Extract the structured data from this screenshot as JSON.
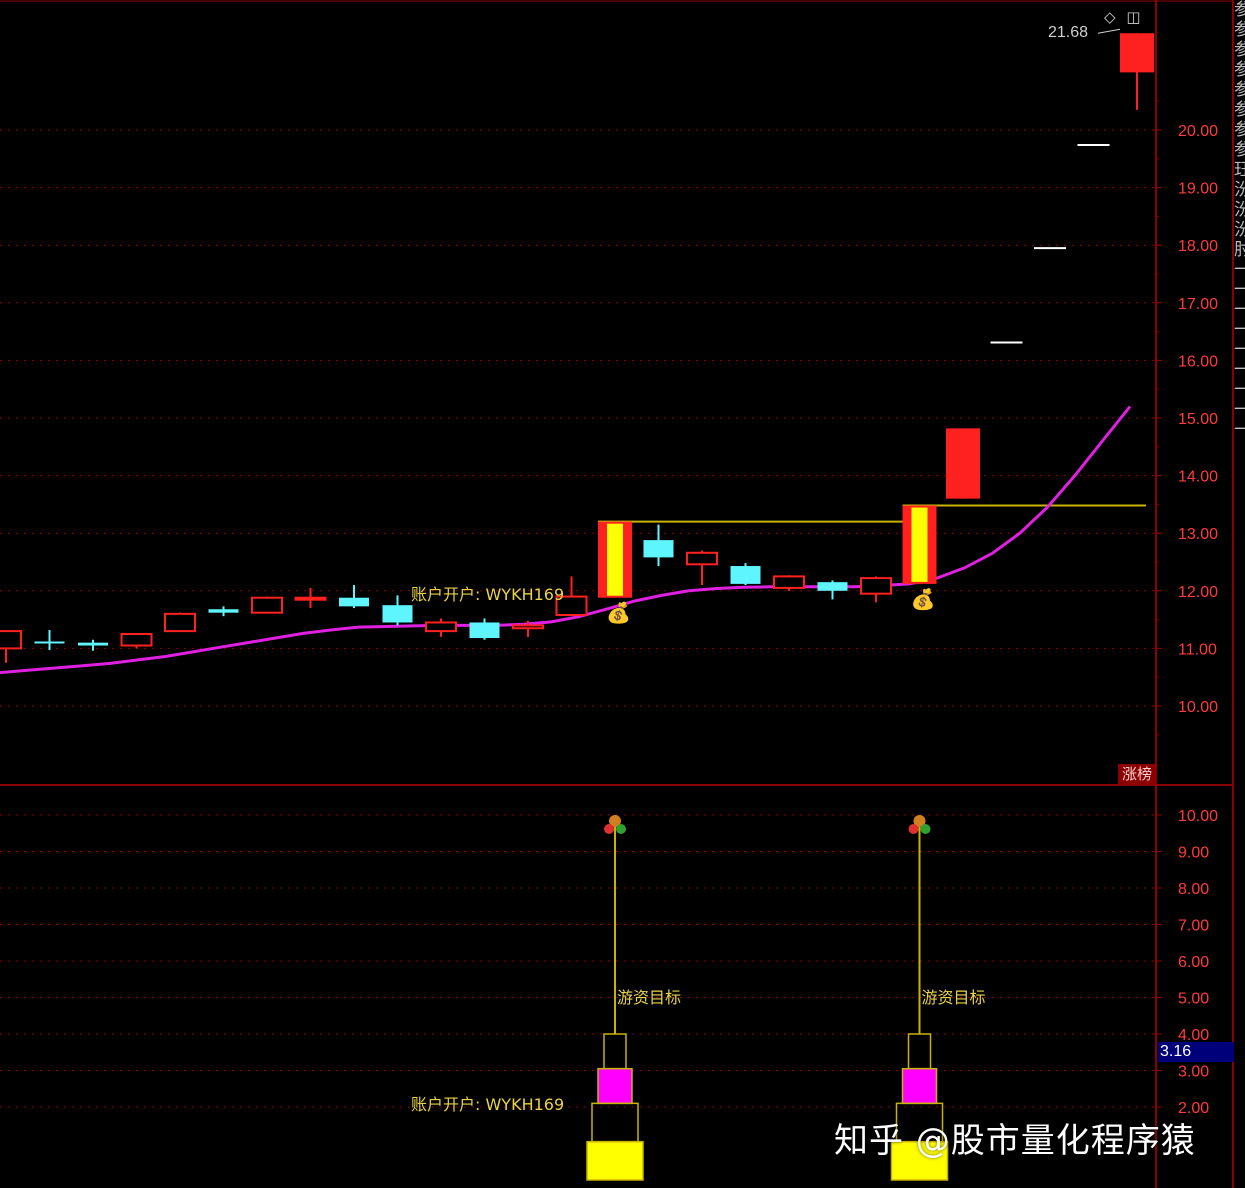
{
  "top_icons": {
    "diamond": "◇",
    "panel": "◫"
  },
  "last_price_label": "21.68",
  "badge_label": "涨榜",
  "current_value_label": "3.16",
  "watermark": "知乎 @股市量化程序猿",
  "annotations": {
    "account_label_1": "账户开户: WYKH169",
    "account_label_2": "账户开户: WYKH169",
    "target_label_1": "游资目标",
    "target_label_2": "游资目标"
  },
  "side_strip_text": "参参参参参参参参 珏汾汾汾 肘 一 一 一 一 一 一 一 一 一",
  "colors": {
    "grid": "#8b0000",
    "axis_text": "#ff3b3b",
    "up_candle": "#ff2020",
    "down_candle": "#5ff5ff",
    "ma_line": "#e020e0",
    "level_line": "#c8b400",
    "highlight": "#ffff00",
    "magenta_block": "#ff00ff"
  },
  "chart_data": [
    {
      "type": "candlestick",
      "ylim": [
        9.0,
        22.0
      ],
      "yticks": [
        "20.00",
        "19.00",
        "18.00",
        "17.00",
        "16.00",
        "15.00",
        "14.00",
        "13.00",
        "12.00",
        "11.00",
        "10.00"
      ],
      "candles": [
        {
          "o": 11.0,
          "h": 11.3,
          "l": 10.75,
          "c": 11.3,
          "dir": "up"
        },
        {
          "o": 11.12,
          "h": 11.32,
          "l": 10.97,
          "c": 11.12,
          "dir": "down"
        },
        {
          "o": 11.1,
          "h": 11.15,
          "l": 10.96,
          "c": 11.05,
          "dir": "down"
        },
        {
          "o": 11.05,
          "h": 11.25,
          "l": 11.0,
          "c": 11.25,
          "dir": "up"
        },
        {
          "o": 11.3,
          "h": 11.62,
          "l": 11.3,
          "c": 11.6,
          "dir": "up"
        },
        {
          "o": 11.68,
          "h": 11.73,
          "l": 11.56,
          "c": 11.62,
          "dir": "down"
        },
        {
          "o": 11.62,
          "h": 11.9,
          "l": 11.62,
          "c": 11.88,
          "dir": "up"
        },
        {
          "o": 11.88,
          "h": 12.05,
          "l": 11.7,
          "c": 11.88,
          "dir": "up"
        },
        {
          "o": 11.88,
          "h": 12.1,
          "l": 11.7,
          "c": 11.73,
          "dir": "down"
        },
        {
          "o": 11.75,
          "h": 11.92,
          "l": 11.4,
          "c": 11.45,
          "dir": "down"
        },
        {
          "o": 11.3,
          "h": 11.52,
          "l": 11.2,
          "c": 11.45,
          "dir": "up"
        },
        {
          "o": 11.45,
          "h": 11.52,
          "l": 11.15,
          "c": 11.18,
          "dir": "down"
        },
        {
          "o": 11.35,
          "h": 11.48,
          "l": 11.2,
          "c": 11.4,
          "dir": "up"
        },
        {
          "o": 11.58,
          "h": 12.25,
          "l": 11.58,
          "c": 11.9,
          "dir": "up"
        },
        {
          "o": 11.88,
          "h": 13.2,
          "l": 11.88,
          "c": 13.2,
          "dir": "limit"
        },
        {
          "o": 12.88,
          "h": 13.15,
          "l": 12.43,
          "c": 12.58,
          "dir": "down"
        },
        {
          "o": 12.46,
          "h": 12.7,
          "l": 12.1,
          "c": 12.66,
          "dir": "up"
        },
        {
          "o": 12.43,
          "h": 12.48,
          "l": 12.1,
          "c": 12.12,
          "dir": "down"
        },
        {
          "o": 12.05,
          "h": 12.27,
          "l": 12.0,
          "c": 12.25,
          "dir": "up"
        },
        {
          "o": 12.15,
          "h": 12.18,
          "l": 11.85,
          "c": 12.0,
          "dir": "down"
        },
        {
          "o": 11.95,
          "h": 12.25,
          "l": 11.8,
          "c": 12.22,
          "dir": "up"
        },
        {
          "o": 12.12,
          "h": 13.48,
          "l": 12.12,
          "c": 13.48,
          "dir": "limit"
        },
        {
          "o": 13.6,
          "h": 14.82,
          "l": 13.6,
          "c": 14.82,
          "dir": "up"
        },
        {
          "o": 16.31,
          "h": 16.31,
          "l": 16.31,
          "c": 16.31,
          "dir": "up"
        },
        {
          "o": 17.95,
          "h": 17.95,
          "l": 17.95,
          "c": 17.95,
          "dir": "up"
        },
        {
          "o": 19.74,
          "h": 19.74,
          "l": 19.74,
          "c": 19.74,
          "dir": "up"
        },
        {
          "o": 21.0,
          "h": 21.68,
          "l": 20.35,
          "c": 21.68,
          "dir": "up"
        }
      ],
      "ma": [
        10.58,
        10.62,
        10.66,
        10.7,
        10.74,
        10.8,
        10.86,
        10.94,
        11.02,
        11.1,
        11.18,
        11.26,
        11.32,
        11.37,
        11.38,
        11.39,
        11.4,
        11.4,
        11.4,
        11.42,
        11.46,
        11.55,
        11.68,
        11.82,
        11.92,
        12.0,
        12.04,
        12.06,
        12.07,
        12.07,
        12.07,
        12.07,
        12.09,
        12.12,
        12.22,
        12.4,
        12.65,
        13.0,
        13.45,
        14.0,
        14.6,
        15.2
      ],
      "levels": [
        {
          "y": 13.2,
          "from": 14,
          "to": 21
        },
        {
          "y": 13.48,
          "from": 21,
          "to": 26
        }
      ]
    },
    {
      "type": "indicator",
      "ylim": [
        1.0,
        11.0
      ],
      "yticks": [
        "10.00",
        "9.00",
        "8.00",
        "7.00",
        "6.00",
        "5.00",
        "4.00",
        "3.00",
        "2.00"
      ],
      "signals": [
        {
          "at": 14,
          "top": 10.0,
          "stack": [
            4.0,
            3.05,
            2.1,
            1.05,
            0.0
          ]
        },
        {
          "at": 21,
          "top": 10.0,
          "stack": [
            4.0,
            3.05,
            2.1,
            1.05,
            0.0
          ]
        }
      ],
      "current": 3.16
    }
  ]
}
